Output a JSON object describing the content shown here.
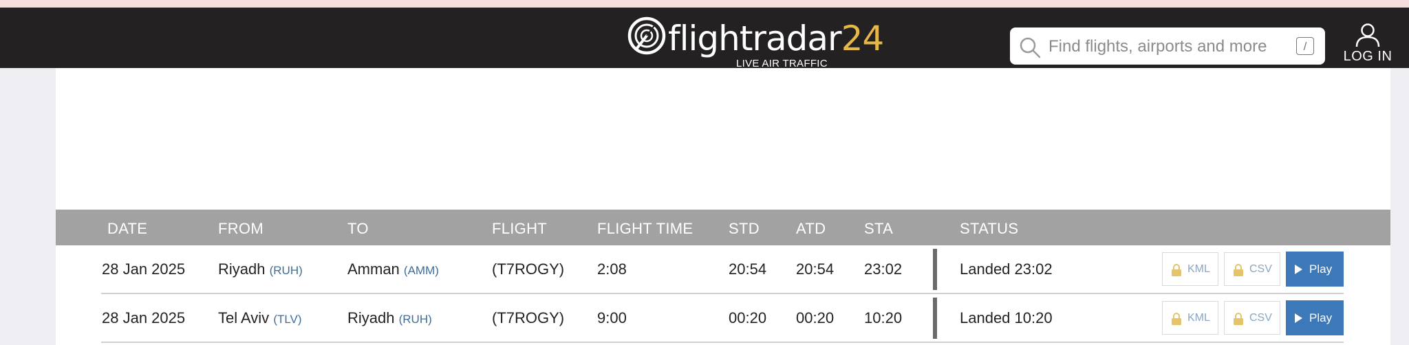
{
  "header": {
    "logo_text": "flightradar",
    "logo_number": "24",
    "logo_subtitle": "LIVE AIR TRAFFIC",
    "search_placeholder": "Find flights, airports and more",
    "search_shortcut": "/",
    "login_label": "LOG IN"
  },
  "table": {
    "columns": [
      "DATE",
      "FROM",
      "TO",
      "FLIGHT",
      "FLIGHT TIME",
      "STD",
      "ATD",
      "STA",
      "STATUS"
    ],
    "rows": [
      {
        "date": "28 Jan 2025",
        "from_city": "Riyadh",
        "from_code": "(RUH)",
        "to_city": "Amman",
        "to_code": "(AMM)",
        "flight": "(T7ROGY)",
        "flight_time": "2:08",
        "std": "20:54",
        "atd": "20:54",
        "sta": "23:02",
        "status": "Landed 23:02",
        "kml_label": "KML",
        "csv_label": "CSV",
        "play_label": "Play"
      },
      {
        "date": "28 Jan 2025",
        "from_city": "Tel Aviv",
        "from_code": "(TLV)",
        "to_city": "Riyadh",
        "to_code": "(RUH)",
        "flight": "(T7ROGY)",
        "flight_time": "9:00",
        "std": "00:20",
        "atd": "00:20",
        "sta": "10:20",
        "status": "Landed 10:20",
        "kml_label": "KML",
        "csv_label": "CSV",
        "play_label": "Play"
      }
    ]
  },
  "colors": {
    "header_bg": "#232122",
    "brand_yellow": "#e5b849",
    "table_header_bg": "#a3a2a2",
    "airport_code": "#3e6d9c",
    "play_button": "#3d78b9",
    "lock_icon": "#e5c36a"
  },
  "icons": [
    "radar-logo-icon",
    "search-icon",
    "user-icon",
    "lock-icon",
    "play-icon"
  ]
}
